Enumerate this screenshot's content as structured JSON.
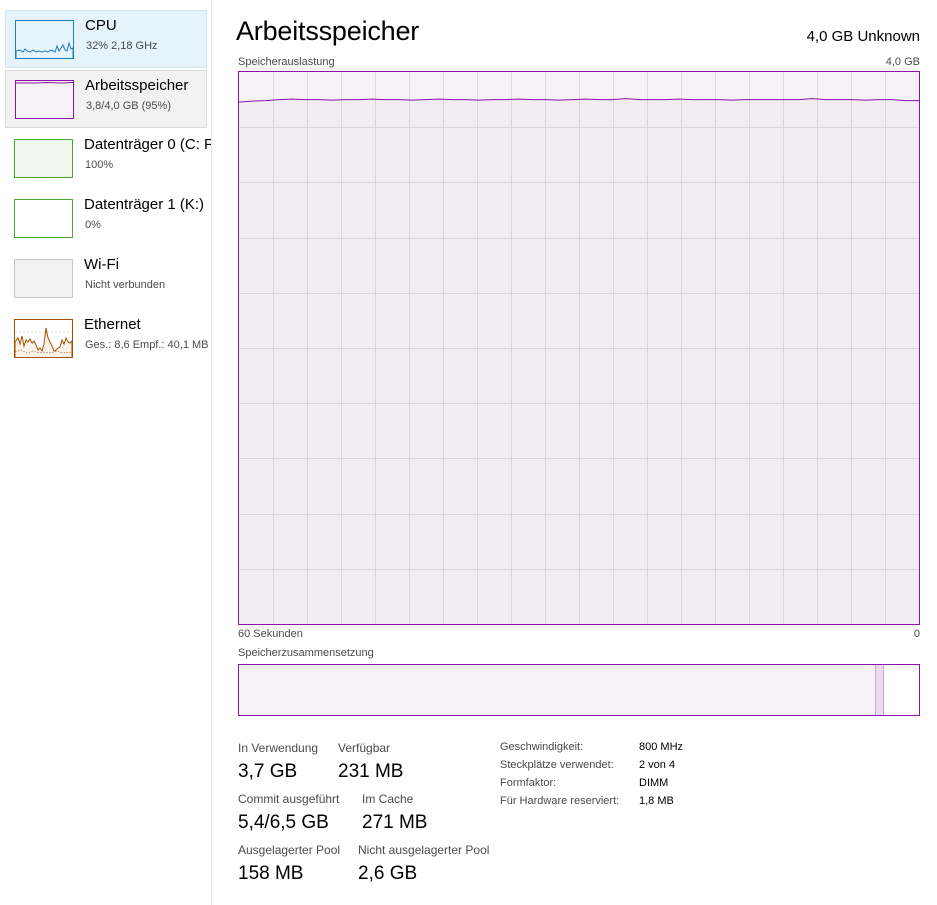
{
  "colors": {
    "cpu": "#1f7fbf",
    "memory": "#8b12ae",
    "disk": "#4da62f",
    "wifi": "#999999",
    "ethernet": "#a74f01"
  },
  "sidebar": {
    "items": [
      {
        "name": "CPU",
        "sub": "32%  2,18 GHz",
        "icon": "cpu-graph-thumbnail"
      },
      {
        "name": "Arbeitsspeicher",
        "sub": "3,8/4,0 GB (95%)",
        "icon": "memory-graph-thumbnail"
      },
      {
        "name": "Datenträger 0 (C: F",
        "sub": "100%",
        "icon": "disk-graph-thumbnail"
      },
      {
        "name": "Datenträger 1 (K:)",
        "sub": "0%",
        "icon": "disk-graph-thumbnail"
      },
      {
        "name": "Wi-Fi",
        "sub": "Nicht verbunden",
        "icon": "wifi-graph-thumbnail"
      },
      {
        "name": "Ethernet",
        "sub": "Ges.: 8,6  Empf.: 40,1 MB",
        "icon": "ethernet-graph-thumbnail"
      }
    ]
  },
  "main": {
    "title": "Arbeitsspeicher",
    "total": "4,0 GB Unknown",
    "usage_graph": {
      "label": "Speicherauslastung",
      "max_label": "4,0 GB",
      "time_label": "60 Sekunden",
      "zero_label": "0",
      "usage_fraction": 0.95
    },
    "composition": {
      "label": "Speicherzusammensetzung",
      "in_use_fraction": 0.937,
      "modified_fraction": 0.012,
      "available_fraction": 0.051
    },
    "stats": {
      "in_use_label": "In Verwendung",
      "in_use": "3,7 GB",
      "available_label": "Verfügbar",
      "available": "231 MB",
      "committed_label": "Commit ausgeführt",
      "committed": "5,4/6,5 GB",
      "cached_label": "Im Cache",
      "cached": "271 MB",
      "paged_label": "Ausgelagerter Pool",
      "paged": "158 MB",
      "nonpaged_label": "Nicht ausgelagerter Pool",
      "nonpaged": "2,6 GB"
    },
    "specs": [
      {
        "label": "Geschwindigkeit:",
        "value": "800 MHz"
      },
      {
        "label": "Steckplätze verwendet:",
        "value": "2 von 4"
      },
      {
        "label": "Formfaktor:",
        "value": "DIMM"
      },
      {
        "label": "Für Hardware reserviert:",
        "value": "1,8 MB"
      }
    ]
  }
}
